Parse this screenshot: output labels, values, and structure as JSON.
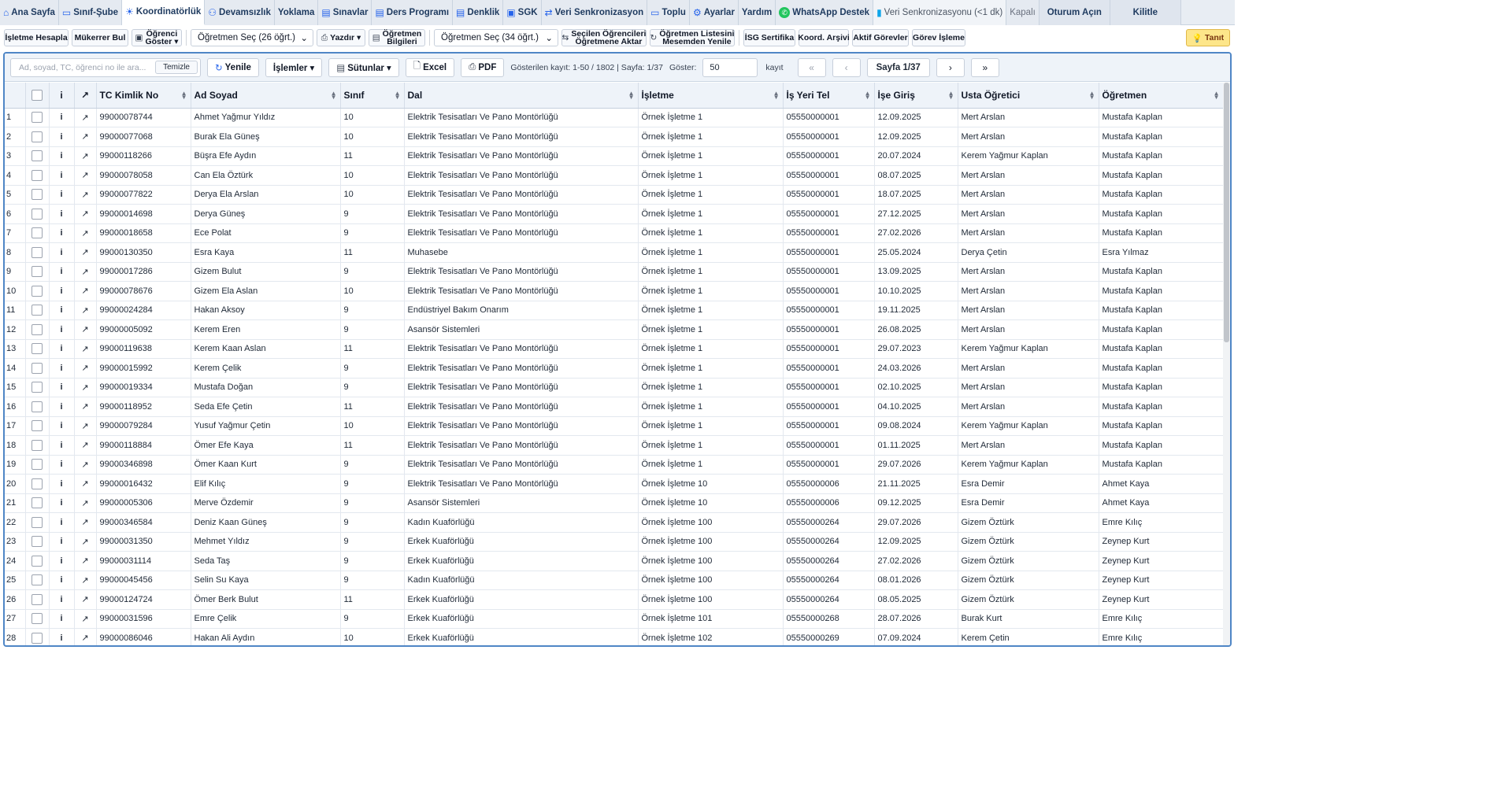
{
  "tabs": [
    {
      "label": "Ana Sayfa",
      "icon": "home-icon",
      "glyph": "⌂",
      "active": false
    },
    {
      "label": "Sınıf-Şube",
      "icon": "monitor-icon",
      "glyph": "▭",
      "active": false
    },
    {
      "label": "Koordinatörlük",
      "icon": "sun-icon",
      "glyph": "☀",
      "active": true
    },
    {
      "label": "Devamsızlık",
      "icon": "people-icon",
      "glyph": "⚇",
      "active": false
    },
    {
      "label": "Yoklama",
      "icon": "",
      "glyph": "",
      "active": false
    },
    {
      "label": "Sınavlar",
      "icon": "document-icon",
      "glyph": "▤",
      "active": false
    },
    {
      "label": "Ders Programı",
      "icon": "document-icon",
      "glyph": "▤",
      "active": false
    },
    {
      "label": "Denklik",
      "icon": "document-icon",
      "glyph": "▤",
      "active": false
    },
    {
      "label": "SGK",
      "icon": "card-icon",
      "glyph": "▣",
      "active": false
    },
    {
      "label": "Veri Senkronizasyon",
      "icon": "sync-icon",
      "glyph": "⇄",
      "active": false
    },
    {
      "label": "Toplu",
      "icon": "message-icon",
      "glyph": "▭",
      "active": false
    },
    {
      "label": "Ayarlar",
      "icon": "gear-icon",
      "glyph": "⚙",
      "active": false
    },
    {
      "label": "Yardım",
      "icon": "",
      "glyph": "",
      "active": false
    },
    {
      "label": "WhatsApp Destek",
      "icon": "whatsapp-icon",
      "glyph": "✆",
      "active": false
    },
    {
      "label": "Veri Senkronizasyonu (<1 dk)",
      "icon": "chart-icon",
      "glyph": "▮",
      "active": false
    },
    {
      "label": "Kapalı",
      "icon": "",
      "glyph": "",
      "active": false
    },
    {
      "label": "Oturum Açın",
      "icon": "",
      "glyph": "",
      "active": false
    },
    {
      "label": "Kilitle",
      "icon": "",
      "glyph": "",
      "active": false
    }
  ],
  "toolbar": {
    "isletme_hesapla": "İşletme Hesapla",
    "mukerrer_bul": "Mükerrer Bul",
    "ogrenci_goster_1": "Öğrenci",
    "ogrenci_goster_2": "Göster ▾",
    "ogretmen_sec_1": "Öğretmen Seç (26 öğrt.)",
    "yazdir": "Yazdır ▾",
    "ogretmen_bilgileri_1": "Öğretmen",
    "ogretmen_bilgileri_2": "Bilgileri",
    "ogretmen_sec_2": "Öğretmen Seç (34 öğrt.)",
    "secilen_1": "Seçilen Öğrencileri",
    "secilen_2": "Öğretmene Aktar",
    "ogretmen_listesi_1": "Öğretmen Listesini",
    "ogretmen_listesi_2": "Mesemden Yenile",
    "isg": "İSG Sertifika",
    "koord_arsivi": "Koord. Arşivi",
    "aktif_gorevler": "Aktif Görevler",
    "gorev_isleme": "Görev İşleme",
    "tanit": "Tanıt"
  },
  "controls": {
    "search_placeholder": "Ad, soyad, TC, öğrenci no ile ara...",
    "temizle": "Temizle",
    "yenile": "Yenile",
    "islemler": "İşlemler ▾",
    "sutunlar": "Sütunlar ▾",
    "excel": "Excel",
    "pdf": "PDF",
    "info": "Gösterilen kayıt: 1-50 / 1802 | Sayfa: 1/37",
    "goster": "Göster:",
    "per_page": "50",
    "kayit": "kayıt",
    "first": "«",
    "prev": "‹",
    "page": "Sayfa 1/37",
    "next": "›",
    "last": "»"
  },
  "columns": [
    "",
    "i",
    "↗",
    "TC Kimlik No",
    "Ad Soyad",
    "Sınıf",
    "Dal",
    "İşletme",
    "İş Yeri Tel",
    "İşe Giriş",
    "Usta Öğretici",
    "Öğretmen"
  ],
  "rows": [
    [
      "1",
      "99000078744",
      "Ahmet Yağmur Yıldız",
      "10",
      "Elektrik Tesisatları Ve Pano Montörlüğü",
      "Örnek İşletme 1",
      "05550000001",
      "12.09.2025",
      "Mert Arslan",
      "Mustafa Kaplan"
    ],
    [
      "2",
      "99000077068",
      "Burak Ela Güneş",
      "10",
      "Elektrik Tesisatları Ve Pano Montörlüğü",
      "Örnek İşletme 1",
      "05550000001",
      "12.09.2025",
      "Mert Arslan",
      "Mustafa Kaplan"
    ],
    [
      "3",
      "99000118266",
      "Büşra Efe Aydın",
      "11",
      "Elektrik Tesisatları Ve Pano Montörlüğü",
      "Örnek İşletme 1",
      "05550000001",
      "20.07.2024",
      "Kerem Yağmur Kaplan",
      "Mustafa Kaplan"
    ],
    [
      "4",
      "99000078058",
      "Can Ela Öztürk",
      "10",
      "Elektrik Tesisatları Ve Pano Montörlüğü",
      "Örnek İşletme 1",
      "05550000001",
      "08.07.2025",
      "Mert Arslan",
      "Mustafa Kaplan"
    ],
    [
      "5",
      "99000077822",
      "Derya Ela Arslan",
      "10",
      "Elektrik Tesisatları Ve Pano Montörlüğü",
      "Örnek İşletme 1",
      "05550000001",
      "18.07.2025",
      "Mert Arslan",
      "Mustafa Kaplan"
    ],
    [
      "6",
      "99000014698",
      "Derya Güneş",
      "9",
      "Elektrik Tesisatları Ve Pano Montörlüğü",
      "Örnek İşletme 1",
      "05550000001",
      "27.12.2025",
      "Mert Arslan",
      "Mustafa Kaplan"
    ],
    [
      "7",
      "99000018658",
      "Ece Polat",
      "9",
      "Elektrik Tesisatları Ve Pano Montörlüğü",
      "Örnek İşletme 1",
      "05550000001",
      "27.02.2026",
      "Mert Arslan",
      "Mustafa Kaplan"
    ],
    [
      "8",
      "99000130350",
      "Esra Kaya",
      "11",
      "Muhasebe",
      "Örnek İşletme 1",
      "05550000001",
      "25.05.2024",
      "Derya Çetin",
      "Esra Yılmaz"
    ],
    [
      "9",
      "99000017286",
      "Gizem Bulut",
      "9",
      "Elektrik Tesisatları Ve Pano Montörlüğü",
      "Örnek İşletme 1",
      "05550000001",
      "13.09.2025",
      "Mert Arslan",
      "Mustafa Kaplan"
    ],
    [
      "10",
      "99000078676",
      "Gizem Ela Aslan",
      "10",
      "Elektrik Tesisatları Ve Pano Montörlüğü",
      "Örnek İşletme 1",
      "05550000001",
      "10.10.2025",
      "Mert Arslan",
      "Mustafa Kaplan"
    ],
    [
      "11",
      "99000024284",
      "Hakan Aksoy",
      "9",
      "Endüstriyel Bakım Onarım",
      "Örnek İşletme 1",
      "05550000001",
      "19.11.2025",
      "Mert Arslan",
      "Mustafa Kaplan"
    ],
    [
      "12",
      "99000005092",
      "Kerem Eren",
      "9",
      "Asansör Sistemleri",
      "Örnek İşletme 1",
      "05550000001",
      "26.08.2025",
      "Mert Arslan",
      "Mustafa Kaplan"
    ],
    [
      "13",
      "99000119638",
      "Kerem Kaan Aslan",
      "11",
      "Elektrik Tesisatları Ve Pano Montörlüğü",
      "Örnek İşletme 1",
      "05550000001",
      "29.07.2023",
      "Kerem Yağmur Kaplan",
      "Mustafa Kaplan"
    ],
    [
      "14",
      "99000015992",
      "Kerem Çelik",
      "9",
      "Elektrik Tesisatları Ve Pano Montörlüğü",
      "Örnek İşletme 1",
      "05550000001",
      "24.03.2026",
      "Mert Arslan",
      "Mustafa Kaplan"
    ],
    [
      "15",
      "99000019334",
      "Mustafa Doğan",
      "9",
      "Elektrik Tesisatları Ve Pano Montörlüğü",
      "Örnek İşletme 1",
      "05550000001",
      "02.10.2025",
      "Mert Arslan",
      "Mustafa Kaplan"
    ],
    [
      "16",
      "99000118952",
      "Seda Efe Çetin",
      "11",
      "Elektrik Tesisatları Ve Pano Montörlüğü",
      "Örnek İşletme 1",
      "05550000001",
      "04.10.2025",
      "Mert Arslan",
      "Mustafa Kaplan"
    ],
    [
      "17",
      "99000079284",
      "Yusuf Yağmur Çetin",
      "10",
      "Elektrik Tesisatları Ve Pano Montörlüğü",
      "Örnek İşletme 1",
      "05550000001",
      "09.08.2024",
      "Kerem Yağmur Kaplan",
      "Mustafa Kaplan"
    ],
    [
      "18",
      "99000118884",
      "Ömer Efe Kaya",
      "11",
      "Elektrik Tesisatları Ve Pano Montörlüğü",
      "Örnek İşletme 1",
      "05550000001",
      "01.11.2025",
      "Mert Arslan",
      "Mustafa Kaplan"
    ],
    [
      "19",
      "99000346898",
      "Ömer Kaan Kurt",
      "9",
      "Elektrik Tesisatları Ve Pano Montörlüğü",
      "Örnek İşletme 1",
      "05550000001",
      "29.07.2026",
      "Kerem Yağmur Kaplan",
      "Mustafa Kaplan"
    ],
    [
      "20",
      "99000016432",
      "Elif Kılıç",
      "9",
      "Elektrik Tesisatları Ve Pano Montörlüğü",
      "Örnek İşletme 10",
      "05550000006",
      "21.11.2025",
      "Esra Demir",
      "Ahmet Kaya"
    ],
    [
      "21",
      "99000005306",
      "Merve Özdemir",
      "9",
      "Asansör Sistemleri",
      "Örnek İşletme 10",
      "05550000006",
      "09.12.2025",
      "Esra Demir",
      "Ahmet Kaya"
    ],
    [
      "22",
      "99000346584",
      "Deniz Kaan Güneş",
      "9",
      "Kadın Kuaförlüğü",
      "Örnek İşletme 100",
      "05550000264",
      "29.07.2026",
      "Gizem Öztürk",
      "Emre Kılıç"
    ],
    [
      "23",
      "99000031350",
      "Mehmet Yıldız",
      "9",
      "Erkek Kuaförlüğü",
      "Örnek İşletme 100",
      "05550000264",
      "12.09.2025",
      "Gizem Öztürk",
      "Zeynep Kurt"
    ],
    [
      "24",
      "99000031114",
      "Seda Taş",
      "9",
      "Erkek Kuaförlüğü",
      "Örnek İşletme 100",
      "05550000264",
      "27.02.2026",
      "Gizem Öztürk",
      "Zeynep Kurt"
    ],
    [
      "25",
      "99000045456",
      "Selin Su Kaya",
      "9",
      "Kadın Kuaförlüğü",
      "Örnek İşletme 100",
      "05550000264",
      "08.01.2026",
      "Gizem Öztürk",
      "Zeynep Kurt"
    ],
    [
      "26",
      "99000124724",
      "Ömer Berk Bulut",
      "11",
      "Erkek Kuaförlüğü",
      "Örnek İşletme 100",
      "05550000264",
      "08.05.2025",
      "Gizem Öztürk",
      "Zeynep Kurt"
    ],
    [
      "27",
      "99000031596",
      "Emre Çelik",
      "9",
      "Erkek Kuaförlüğü",
      "Örnek İşletme 101",
      "05550000268",
      "28.07.2026",
      "Burak Kurt",
      "Emre Kılıç"
    ],
    [
      "28",
      "99000086046",
      "Hakan Ali Aydın",
      "10",
      "Erkek Kuaförlüğü",
      "Örnek İşletme 102",
      "05550000269",
      "07.09.2024",
      "Kerem Çetin",
      "Emre Kılıç"
    ]
  ]
}
